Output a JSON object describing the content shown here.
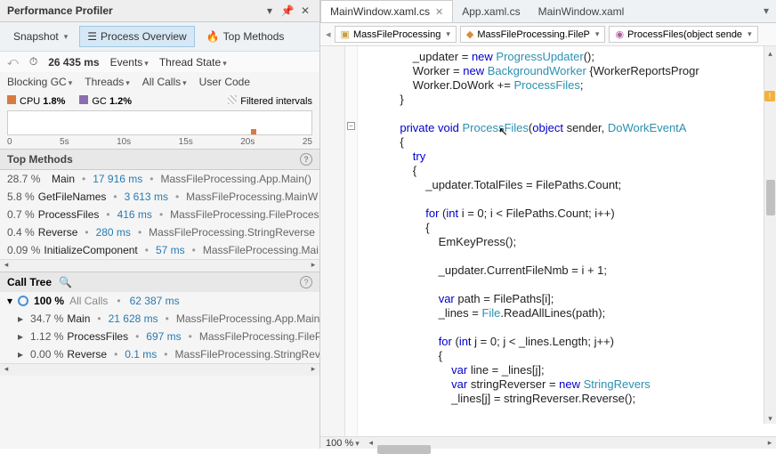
{
  "profiler": {
    "title": "Performance Profiler",
    "snapshot_label": "Snapshot",
    "process_overview_label": "Process Overview",
    "top_methods_btn": "Top Methods",
    "total_time": "26 435 ms",
    "events_label": "Events",
    "thread_state_label": "Thread State",
    "filters": {
      "blocking_gc": "Blocking GC",
      "threads": "Threads",
      "all_calls": "All Calls",
      "user_code": "User Code"
    },
    "legend": {
      "cpu_label": "CPU",
      "cpu_value": "1.8%",
      "gc_label": "GC",
      "gc_value": "1.2%",
      "filtered_label": "Filtered intervals"
    },
    "axis": {
      "t0": "0",
      "t1": "5s",
      "t2": "10s",
      "t3": "15s",
      "t4": "20s",
      "t5": "25"
    },
    "top_methods_title": "Top Methods",
    "methods": [
      {
        "pct": "28.7 %",
        "name": "Main",
        "time": "17 916 ms",
        "ns": "MassFileProcessing.App.Main()"
      },
      {
        "pct": "5.8 %",
        "name": "GetFileNames",
        "time": "3 613 ms",
        "ns": "MassFileProcessing.MainW"
      },
      {
        "pct": "0.7 %",
        "name": "ProcessFiles",
        "time": "416 ms",
        "ns": "MassFileProcessing.FileProces"
      },
      {
        "pct": "0.4 %",
        "name": "Reverse",
        "time": "280 ms",
        "ns": "MassFileProcessing.StringReverse"
      },
      {
        "pct": "0.09 %",
        "name": "InitializeComponent",
        "time": "57 ms",
        "ns": "MassFileProcessing.Mai"
      }
    ],
    "call_tree_title": "Call Tree",
    "summary_pct": "100 %",
    "summary_name": "All Calls",
    "summary_time": "62 387 ms",
    "tree": [
      {
        "pct": "34.7 %",
        "name": "Main",
        "time": "21 628 ms",
        "ns": "MassFileProcessing.App.Main()"
      },
      {
        "pct": "1.12 %",
        "name": "ProcessFiles",
        "time": "697 ms",
        "ns": "MassFileProcessing.FileProces"
      },
      {
        "pct": "0.00 %",
        "name": "Reverse",
        "time": "0.1 ms",
        "ns": "MassFileProcessing.StringRever"
      }
    ]
  },
  "editor": {
    "tabs": [
      {
        "label": "MainWindow.xaml.cs",
        "active": true
      },
      {
        "label": "App.xaml.cs",
        "active": false
      },
      {
        "label": "MainWindow.xaml",
        "active": false
      }
    ],
    "breadcrumb": {
      "ns": "MassFileProcessing",
      "class": "MassFileProcessing.FileP",
      "method": "ProcessFiles(object sende"
    },
    "zoom_label": "100 %",
    "code_lines": [
      "                _updater = new ProgressUpdater();",
      "                Worker = new BackgroundWorker {WorkerReportsProgr",
      "                Worker.DoWork += ProcessFiles;",
      "            }",
      "",
      "            private void ProcessFiles(object sender, DoWorkEventA",
      "            {",
      "                try",
      "                {",
      "                    _updater.TotalFiles = FilePaths.Count;",
      "",
      "                    for (int i = 0; i < FilePaths.Count; i++)",
      "                    {",
      "                        EmKeyPress();",
      "",
      "                        _updater.CurrentFileNmb = i + 1;",
      "",
      "                        var path = FilePaths[i];",
      "                        _lines = File.ReadAllLines(path);",
      "",
      "                        for (int j = 0; j < _lines.Length; j++)",
      "                        {",
      "                            var line = _lines[j];",
      "                            var stringReverser = new StringRevers",
      "                            _lines[j] = stringReverser.Reverse();"
    ]
  }
}
